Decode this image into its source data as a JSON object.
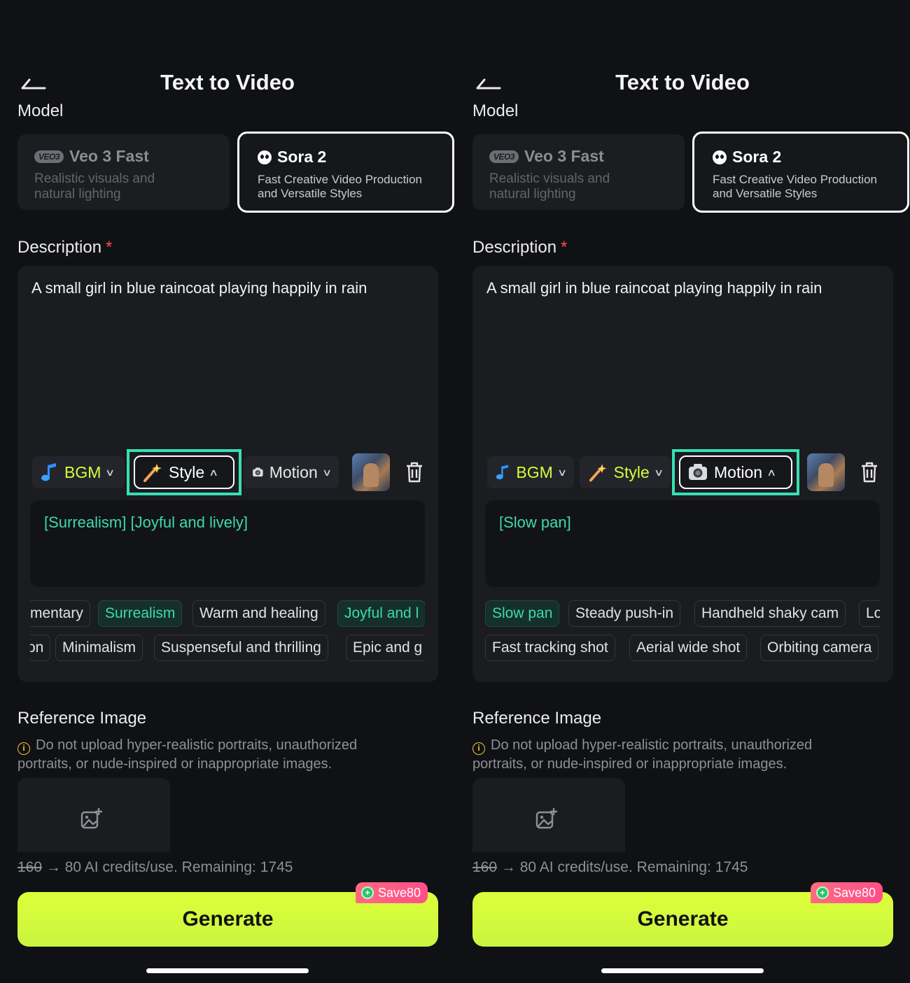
{
  "panels": [
    {
      "header": {
        "title": "Text to Video"
      },
      "model_label": "Model",
      "models": [
        {
          "badge": "VEO3",
          "name": "Veo 3 Fast",
          "desc_line1": "Realistic visuals and",
          "desc_line2": "natural lighting"
        },
        {
          "name": "Sora 2",
          "desc_line1": "Fast Creative Video Production",
          "desc_line2": "and Versatile Styles",
          "selected": true
        }
      ],
      "description": {
        "label": "Description",
        "required": "*",
        "text": "A small girl in blue raincoat playing happily in rain"
      },
      "toolbar": {
        "bgm": "BGM",
        "style": "Style",
        "motion": "Motion",
        "active": "Style"
      },
      "selected_tags": "[Surrealism] [Joyful and lively]",
      "chips_row1": [
        "mentary",
        "Surrealism",
        "Warm and healing",
        "Joyful and l"
      ],
      "chips_row2": [
        "on",
        "Minimalism",
        "Suspenseful and thrilling",
        "Epic and g"
      ],
      "reference": {
        "label": "Reference Image",
        "warning": "Do not upload hyper-realistic portraits, unauthorized portraits, or nude-inspired or inappropriate images."
      },
      "credits": {
        "old": "160",
        "arrow": "→",
        "text": "80 AI credits/use. Remaining: 1745"
      },
      "save_badge": "Save80",
      "generate": "Generate"
    },
    {
      "header": {
        "title": "Text to Video"
      },
      "model_label": "Model",
      "models": [
        {
          "badge": "VEO3",
          "name": "Veo 3 Fast",
          "desc_line1": "Realistic visuals and",
          "desc_line2": "natural lighting"
        },
        {
          "name": "Sora 2",
          "desc_line1": "Fast Creative Video Production",
          "desc_line2": "and Versatile Styles",
          "selected": true
        }
      ],
      "description": {
        "label": "Description",
        "required": "*",
        "text": "A small girl in blue raincoat playing happily in rain"
      },
      "toolbar": {
        "bgm": "BGM",
        "style": "Style",
        "motion": "Motion",
        "active": "Motion"
      },
      "selected_tags": "[Slow pan]",
      "chips_row1": [
        "Slow pan",
        "Steady push-in",
        "Handheld shaky cam",
        "Lo"
      ],
      "chips_row2": [
        "Fast tracking shot",
        "Aerial wide shot",
        "Orbiting camera"
      ],
      "reference": {
        "label": "Reference Image",
        "warning": "Do not upload hyper-realistic portraits, unauthorized portraits, or nude-inspired or inappropriate images."
      },
      "credits": {
        "old": "160",
        "arrow": "→",
        "text": "80 AI credits/use. Remaining: 1745"
      },
      "save_badge": "Save80",
      "generate": "Generate"
    }
  ],
  "colors": {
    "accent_lime": "#d6ff3a",
    "accent_teal": "#3dd9ae",
    "highlight": "#37e0b3",
    "badge_pink": "#ff5a86",
    "background": "#101114"
  }
}
